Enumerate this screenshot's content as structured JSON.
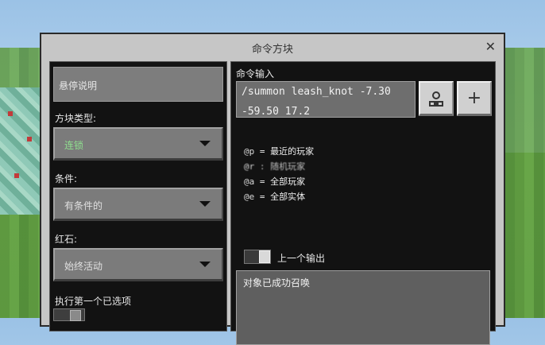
{
  "window": {
    "title": "命令方块",
    "close_glyph": "✕"
  },
  "left_panel": {
    "hover_note": "悬停说明",
    "block_type": {
      "label": "方块类型:",
      "value": "连锁"
    },
    "condition": {
      "label": "条件:",
      "value": "有条件的"
    },
    "redstone": {
      "label": "红石:",
      "value": "始终活动"
    },
    "execute_first": {
      "label": "执行第一个已选项"
    }
  },
  "right_panel": {
    "command_input": {
      "label": "命令输入",
      "line1": "/summon leash_knot -7.30",
      "line2": "-59.50 17.2"
    },
    "buttons": {
      "selector_icon": "person-select-icon",
      "add_icon": "plus-icon",
      "add_glyph": "+"
    },
    "selectors": [
      {
        "key": "@p",
        "sep": " = ",
        "desc": "最近的玩家"
      },
      {
        "key": "@r",
        "sep": " : ",
        "desc": "随机玩家"
      },
      {
        "key": "@a",
        "sep": " = ",
        "desc": "全部玩家"
      },
      {
        "key": "@e",
        "sep": " = ",
        "desc": "全部实体"
      }
    ],
    "previous_output": {
      "label": "上一个输出"
    },
    "output_text": "对象已成功召唤"
  },
  "colors": {
    "panel_bg": "#121212",
    "window_bg": "#c6c6c6",
    "dropdown_bg": "#7b7b7b",
    "chain_green": "#8fe08f"
  }
}
